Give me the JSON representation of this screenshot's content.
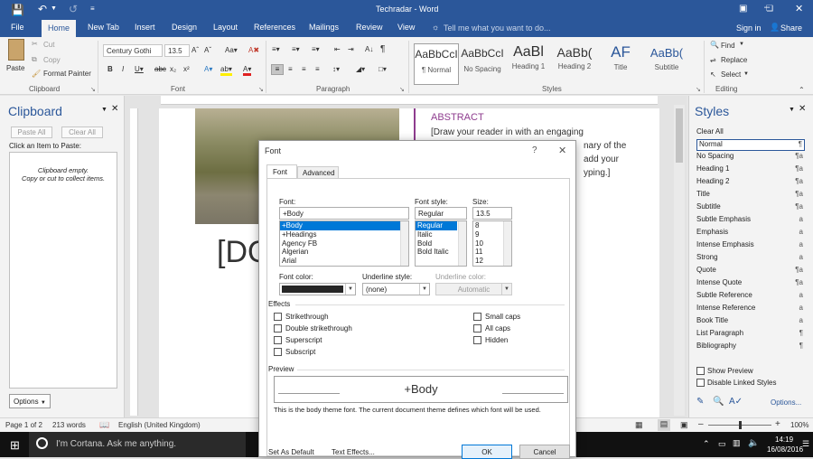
{
  "window": {
    "title": "Techradar - Word",
    "sign_in": "Sign in",
    "share": "Share",
    "tell_me": "Tell me what you want to do..."
  },
  "tabs": [
    "File",
    "Home",
    "New Tab",
    "Insert",
    "Design",
    "Layout",
    "References",
    "Mailings",
    "Review",
    "View"
  ],
  "ribbon": {
    "clipboard": {
      "paste": "Paste",
      "cut": "Cut",
      "copy": "Copy",
      "format_painter": "Format Painter",
      "label": "Clipboard"
    },
    "font": {
      "name": "Century Gothi",
      "size": "13.5",
      "label": "Font"
    },
    "paragraph": {
      "label": "Paragraph"
    },
    "styles": {
      "label": "Styles",
      "items": [
        {
          "sample": "AaBbCcI",
          "name": "¶ Normal"
        },
        {
          "sample": "AaBbCcI",
          "name": "No Spacing"
        },
        {
          "sample": "AaBl",
          "name": "Heading 1"
        },
        {
          "sample": "AaBb(",
          "name": "Heading 2"
        },
        {
          "sample": "AF",
          "name": "Title"
        },
        {
          "sample": "AaBb(",
          "name": "Subtitle"
        }
      ]
    },
    "editing": {
      "find": "Find",
      "replace": "Replace",
      "select": "Select",
      "label": "Editing"
    }
  },
  "clipboard_pane": {
    "title": "Clipboard",
    "paste_all": "Paste All",
    "clear_all": "Clear All",
    "hint": "Click an Item to Paste:",
    "empty_line1": "Clipboard empty.",
    "empty_line2": "Copy or cut to collect items.",
    "options": "Options"
  },
  "document": {
    "abstract_heading": "ABSTRACT",
    "abstract_line1": "[Draw your reader in with an engaging",
    "abstract_line2": "nary of the",
    "abstract_line3": "add your",
    "abstract_line4": "yping.]",
    "big_text": "[DO"
  },
  "styles_pane": {
    "title": "Styles",
    "items": [
      {
        "name": "Clear All",
        "mark": ""
      },
      {
        "name": "Normal",
        "mark": "¶"
      },
      {
        "name": "No Spacing",
        "mark": "¶a"
      },
      {
        "name": "Heading 1",
        "mark": "¶a"
      },
      {
        "name": "Heading 2",
        "mark": "¶a"
      },
      {
        "name": "Title",
        "mark": "¶a"
      },
      {
        "name": "Subtitle",
        "mark": "¶a"
      },
      {
        "name": "Subtle Emphasis",
        "mark": "a"
      },
      {
        "name": "Emphasis",
        "mark": "a"
      },
      {
        "name": "Intense Emphasis",
        "mark": "a"
      },
      {
        "name": "Strong",
        "mark": "a"
      },
      {
        "name": "Quote",
        "mark": "¶a"
      },
      {
        "name": "Intense Quote",
        "mark": "¶a"
      },
      {
        "name": "Subtle Reference",
        "mark": "a"
      },
      {
        "name": "Intense Reference",
        "mark": "a"
      },
      {
        "name": "Book Title",
        "mark": "a"
      },
      {
        "name": "List Paragraph",
        "mark": "¶"
      },
      {
        "name": "Bibliography",
        "mark": "¶"
      }
    ],
    "show_preview": "Show Preview",
    "disable_linked": "Disable Linked Styles",
    "options": "Options..."
  },
  "dialog": {
    "title": "Font",
    "help": "?",
    "tabs": [
      "Font",
      "Advanced"
    ],
    "font_label": "Font:",
    "font_value": "+Body",
    "font_list": [
      "+Body",
      "+Headings",
      "Agency FB",
      "Algerian",
      "Arial"
    ],
    "style_label": "Font style:",
    "style_value": "Regular",
    "style_list": [
      "Regular",
      "Italic",
      "Bold",
      "Bold Italic"
    ],
    "size_label": "Size:",
    "size_value": "13.5",
    "size_list": [
      "8",
      "9",
      "10",
      "11",
      "12"
    ],
    "font_color_label": "Font color:",
    "underline_label": "Underline style:",
    "underline_value": "(none)",
    "underline_color_label": "Underline color:",
    "underline_color_value": "Automatic",
    "effects_label": "Effects",
    "effects_left": [
      "Strikethrough",
      "Double strikethrough",
      "Superscript",
      "Subscript"
    ],
    "effects_right": [
      "Small caps",
      "All caps",
      "Hidden"
    ],
    "preview_label": "Preview",
    "preview_text": "+Body",
    "description": "This is the body theme font. The current document theme defines which font will be used.",
    "set_default": "Set As Default",
    "text_effects": "Text Effects...",
    "ok": "OK",
    "cancel": "Cancel"
  },
  "status": {
    "page": "Page 1 of 2",
    "words": "213 words",
    "language": "English (United Kingdom)",
    "zoom": "100%"
  },
  "taskbar": {
    "cortana": "I'm Cortana. Ask me anything.",
    "time": "14:19",
    "date": "16/08/2016"
  },
  "colors": {
    "word_blue": "#2b579a",
    "accent_purple": "#8e3c8e",
    "selection": "#0078d7"
  }
}
